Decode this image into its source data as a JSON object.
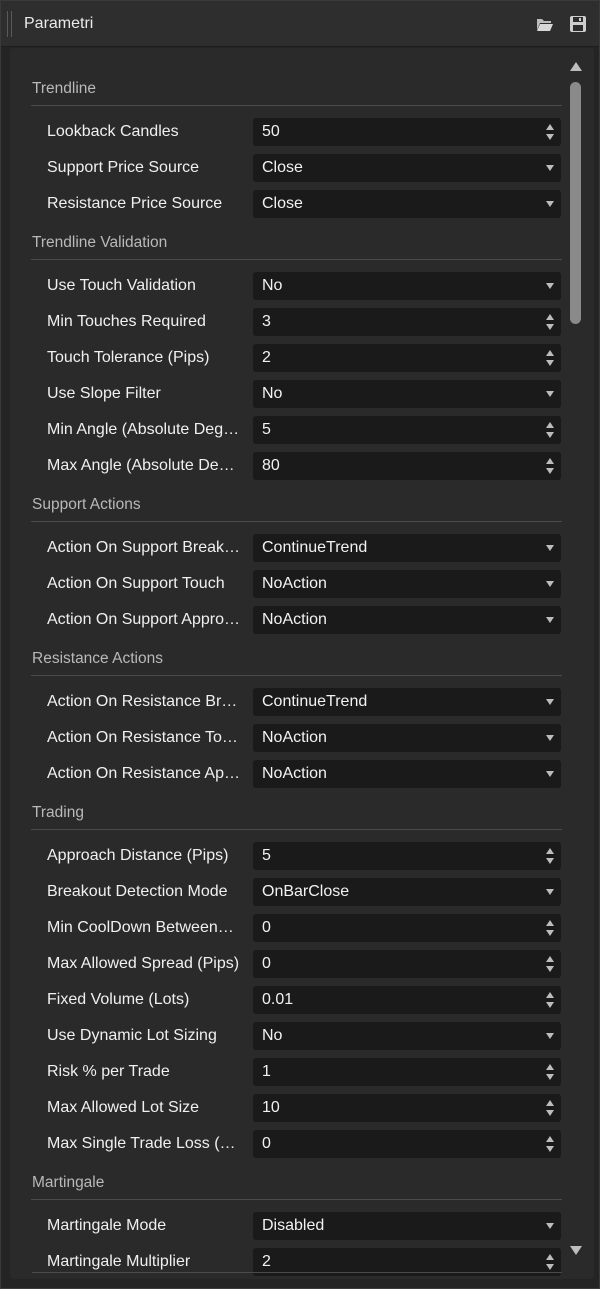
{
  "window": {
    "title": "Parametri",
    "icons": [
      "open-folder-icon",
      "save-icon"
    ]
  },
  "sections": [
    {
      "title": "Trendline",
      "rows": [
        {
          "label": "Lookback Candles",
          "value": "50",
          "kind": "spin"
        },
        {
          "label": "Support Price Source",
          "value": "Close",
          "kind": "select"
        },
        {
          "label": "Resistance Price Source",
          "value": "Close",
          "kind": "select"
        }
      ]
    },
    {
      "title": "Trendline Validation",
      "rows": [
        {
          "label": "Use Touch Validation",
          "value": "No",
          "kind": "select"
        },
        {
          "label": "Min Touches Required",
          "value": "3",
          "kind": "spin"
        },
        {
          "label": "Touch Tolerance (Pips)",
          "value": "2",
          "kind": "spin"
        },
        {
          "label": "Use Slope Filter",
          "value": "No",
          "kind": "select"
        },
        {
          "label": "Min Angle (Absolute Deg…",
          "value": "5",
          "kind": "spin"
        },
        {
          "label": "Max Angle (Absolute De…",
          "value": "80",
          "kind": "spin"
        }
      ]
    },
    {
      "title": "Support Actions",
      "rows": [
        {
          "label": "Action On Support Break…",
          "value": "ContinueTrend",
          "kind": "select"
        },
        {
          "label": "Action On Support Touch",
          "value": "NoAction",
          "kind": "select"
        },
        {
          "label": "Action On Support Appro…",
          "value": "NoAction",
          "kind": "select"
        }
      ]
    },
    {
      "title": "Resistance Actions",
      "rows": [
        {
          "label": "Action On Resistance Br…",
          "value": "ContinueTrend",
          "kind": "select"
        },
        {
          "label": "Action On Resistance To…",
          "value": "NoAction",
          "kind": "select"
        },
        {
          "label": "Action On Resistance Ap…",
          "value": "NoAction",
          "kind": "select"
        }
      ]
    },
    {
      "title": "Trading",
      "rows": [
        {
          "label": "Approach Distance (Pips)",
          "value": "5",
          "kind": "spin"
        },
        {
          "label": "Breakout Detection Mode",
          "value": "OnBarClose",
          "kind": "select"
        },
        {
          "label": "Min CoolDown Between…",
          "value": "0",
          "kind": "spin"
        },
        {
          "label": "Max Allowed Spread (Pips)",
          "value": "0",
          "kind": "spin"
        },
        {
          "label": "Fixed Volume (Lots)",
          "value": "0.01",
          "kind": "spin"
        },
        {
          "label": "Use Dynamic Lot Sizing",
          "value": "No",
          "kind": "select"
        },
        {
          "label": "Risk % per Trade",
          "value": "1",
          "kind": "spin"
        },
        {
          "label": "Max Allowed Lot Size",
          "value": "10",
          "kind": "spin"
        },
        {
          "label": "Max Single Trade Loss (…",
          "value": "0",
          "kind": "spin"
        }
      ]
    },
    {
      "title": "Martingale",
      "rows": [
        {
          "label": "Martingale Mode",
          "value": "Disabled",
          "kind": "select"
        },
        {
          "label": "Martingale Multiplier",
          "value": "2",
          "kind": "spin"
        }
      ]
    }
  ],
  "colors": {
    "background": "#242424",
    "panel": "#2a2a2a",
    "field": "#1a1a1a",
    "text": "#f0f0f0",
    "section_text": "#b9b9b9"
  }
}
